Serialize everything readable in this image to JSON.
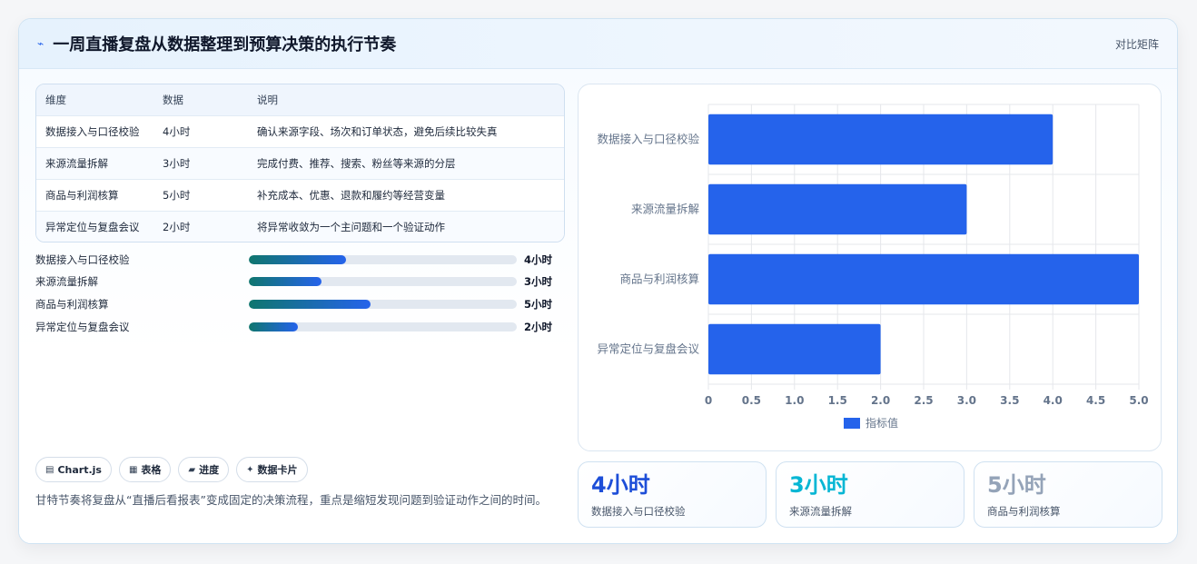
{
  "header": {
    "icon": "bolt-icon",
    "title": "一周直播复盘从数据整理到预算决策的执行节奏",
    "right_label": "对比矩阵"
  },
  "table": {
    "headers": [
      "维度",
      "数据",
      "说明"
    ],
    "rows": [
      [
        "数据接入与口径校验",
        "4小时",
        "确认来源字段、场次和订单状态，避免后续比较失真"
      ],
      [
        "来源流量拆解",
        "3小时",
        "完成付费、推荐、搜索、粉丝等来源的分层"
      ],
      [
        "商品与利润核算",
        "5小时",
        "补充成本、优惠、退款和履约等经营变量"
      ],
      [
        "异常定位与复盘会议",
        "2小时",
        "将异常收敛为一个主问题和一个验证动作"
      ]
    ]
  },
  "progress": [
    {
      "label": "数据接入与口径校验",
      "value": 4,
      "max": 11,
      "text": "4小时"
    },
    {
      "label": "来源流量拆解",
      "value": 3,
      "max": 11,
      "text": "3小时"
    },
    {
      "label": "商品与利润核算",
      "value": 5,
      "max": 11,
      "text": "5小时"
    },
    {
      "label": "异常定位与复盘会议",
      "value": 2,
      "max": 11,
      "text": "2小时"
    }
  ],
  "chips": [
    {
      "icon": "monitor-icon",
      "glyph": "▤",
      "label": "Chart.js"
    },
    {
      "icon": "table-icon",
      "glyph": "▦",
      "label": "表格"
    },
    {
      "icon": "progress-icon",
      "glyph": "▰",
      "label": "进度"
    },
    {
      "icon": "sparkle-icon",
      "glyph": "✦",
      "label": "数据卡片"
    }
  ],
  "note": "甘特节奏将复盘从“直播后看报表”变成固定的决策流程，重点是缩短发现问题到验证动作之间的时间。",
  "stats": [
    {
      "value": "4小时",
      "label": "数据接入与口径校验",
      "color": "#1d4ed8"
    },
    {
      "value": "3小时",
      "label": "来源流量拆解",
      "color": "#06b6d4"
    },
    {
      "value": "5小时",
      "label": "商品与利润核算",
      "color": "#94a3b8"
    }
  ],
  "chart_data": {
    "type": "bar",
    "orientation": "horizontal",
    "categories": [
      "数据接入与口径校验",
      "来源流量拆解",
      "商品与利润核算",
      "异常定位与复盘会议"
    ],
    "series": [
      {
        "name": "指标值",
        "values": [
          4,
          3,
          5,
          2
        ],
        "color": "#2563eb"
      }
    ],
    "xlim": [
      0,
      5
    ],
    "xticks": [
      "0",
      "0.5",
      "1.0",
      "1.5",
      "2.0",
      "2.5",
      "3.0",
      "3.5",
      "4.0",
      "4.5",
      "5.0"
    ],
    "grid": true,
    "legend": "bottom"
  }
}
